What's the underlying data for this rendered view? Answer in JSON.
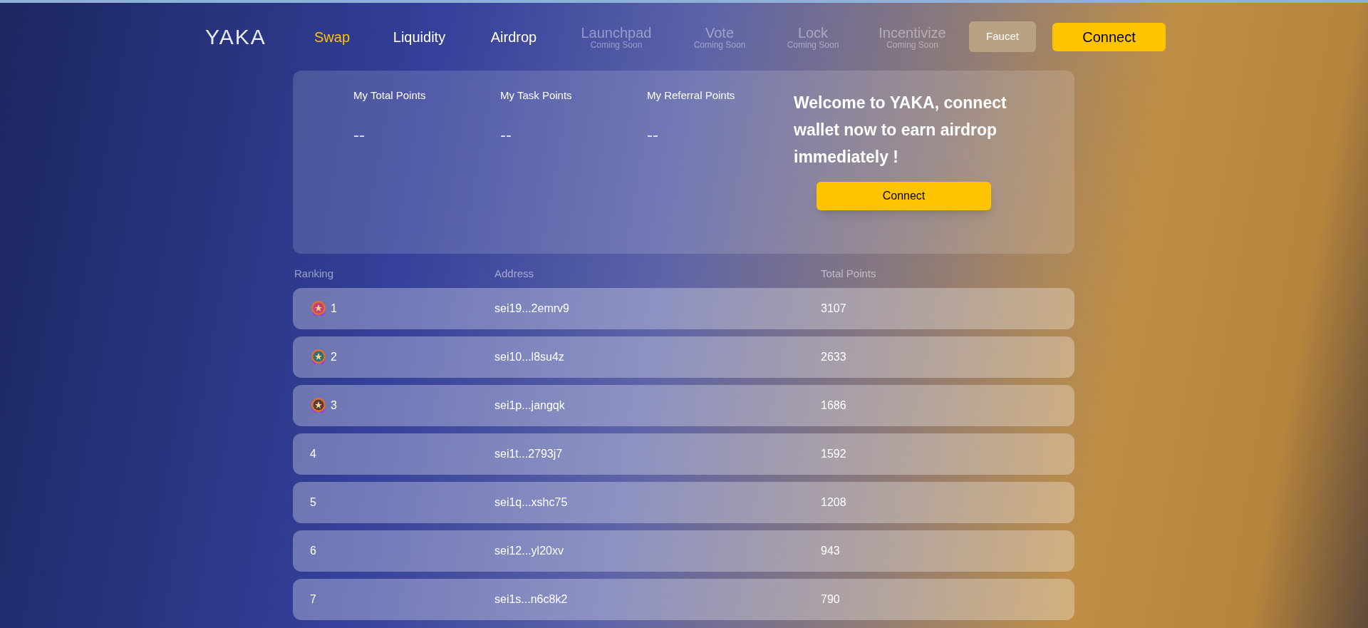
{
  "logo": {
    "text": "YAKA"
  },
  "nav": [
    {
      "label": "Swap",
      "selected": true,
      "disabled": false
    },
    {
      "label": "Liquidity",
      "selected": false,
      "disabled": false
    },
    {
      "label": "Airdrop",
      "selected": false,
      "disabled": false
    },
    {
      "label": "Launchpad",
      "note": "Coming Soon",
      "selected": false,
      "disabled": true
    },
    {
      "label": "Vote",
      "note": "Coming Soon",
      "selected": false,
      "disabled": true
    },
    {
      "label": "Lock",
      "note": "Coming Soon",
      "selected": false,
      "disabled": true
    },
    {
      "label": "Incentivize",
      "note": "Coming Soon",
      "selected": false,
      "disabled": true
    }
  ],
  "faucet_button": "Faucet",
  "connect_button": "Connect",
  "points": [
    {
      "label": "My Total Points",
      "value": "--"
    },
    {
      "label": "My Task Points",
      "value": "--"
    },
    {
      "label": "My Referral Points",
      "value": "--"
    }
  ],
  "welcome": {
    "message": "Welcome to YAKA, connect wallet now to earn airdrop immediately !",
    "button": "Connect"
  },
  "leaderboard": {
    "columns": [
      "Ranking",
      "Address",
      "Total Points"
    ],
    "rows": [
      {
        "rank": "1",
        "medal": true,
        "color": "#c0407a",
        "address": "sei19...2emrv9",
        "points": "3107"
      },
      {
        "rank": "2",
        "medal": true,
        "color": "#2f6f78",
        "address": "sei10...l8su4z",
        "points": "2633"
      },
      {
        "rank": "3",
        "medal": true,
        "color": "#5a3a3a",
        "address": "sei1p...jangqk",
        "points": "1686"
      },
      {
        "rank": "4",
        "medal": false,
        "address": "sei1t...2793j7",
        "points": "1592"
      },
      {
        "rank": "5",
        "medal": false,
        "address": "sei1q...xshc75",
        "points": "1208"
      },
      {
        "rank": "6",
        "medal": false,
        "address": "sei12...yl20xv",
        "points": "943"
      },
      {
        "rank": "7",
        "medal": false,
        "address": "sei1s...n6c8k2",
        "points": "790"
      }
    ]
  }
}
